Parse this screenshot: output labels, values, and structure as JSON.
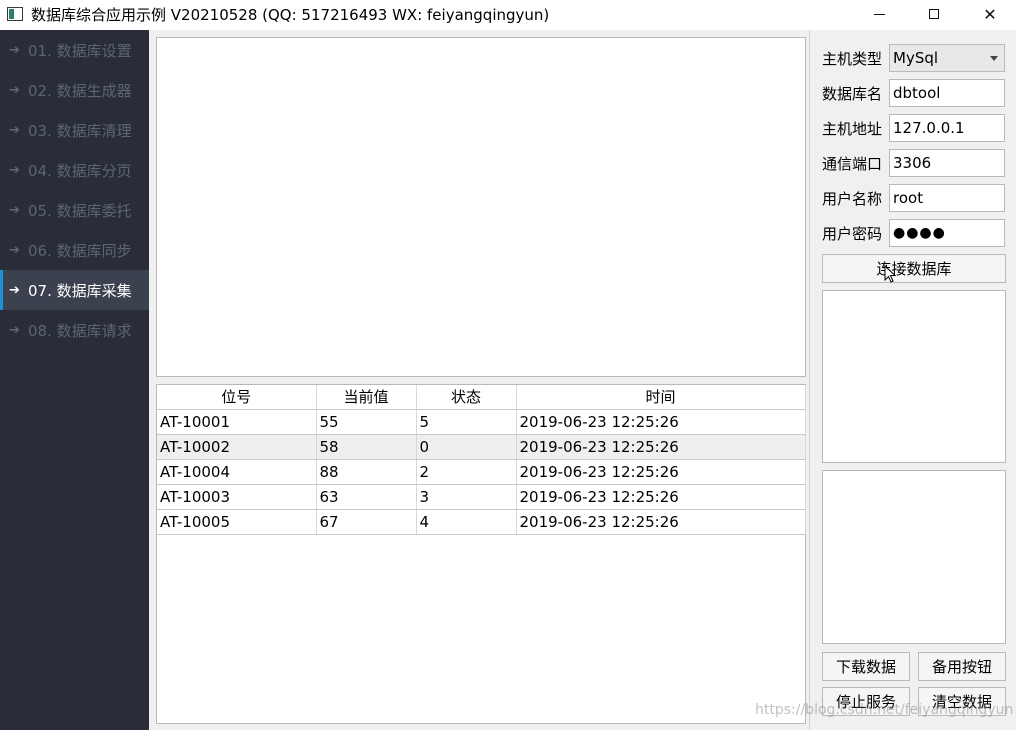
{
  "window": {
    "title": "数据库综合应用示例 V20210528 (QQ: 517216493 WX: feiyangqingyun)"
  },
  "sidebar": {
    "items": [
      {
        "label": "01. 数据库设置"
      },
      {
        "label": "02. 数据生成器"
      },
      {
        "label": "03. 数据库清理"
      },
      {
        "label": "04. 数据库分页"
      },
      {
        "label": "05. 数据库委托"
      },
      {
        "label": "06. 数据库同步"
      },
      {
        "label": "07. 数据库采集",
        "active": true
      },
      {
        "label": "08. 数据库请求"
      }
    ]
  },
  "table": {
    "headers": [
      "位号",
      "当前值",
      "状态",
      "时间"
    ],
    "rows": [
      [
        "AT-10001",
        "55",
        "5",
        "2019-06-23 12:25:26"
      ],
      [
        "AT-10002",
        "58",
        "0",
        "2019-06-23 12:25:26"
      ],
      [
        "AT-10004",
        "88",
        "2",
        "2019-06-23 12:25:26"
      ],
      [
        "AT-10003",
        "63",
        "3",
        "2019-06-23 12:25:26"
      ],
      [
        "AT-10005",
        "67",
        "4",
        "2019-06-23 12:25:26"
      ]
    ]
  },
  "form": {
    "host_type_label": "主机类型",
    "host_type_value": "MySql",
    "db_name_label": "数据库名",
    "db_name_value": "dbtool",
    "host_addr_label": "主机地址",
    "host_addr_value": "127.0.0.1",
    "port_label": "通信端口",
    "port_value": "3306",
    "user_label": "用户名称",
    "user_value": "root",
    "password_label": "用户密码",
    "password_value": "●●●●",
    "connect_button": "连接数据库"
  },
  "buttons": {
    "download": "下载数据",
    "spare": "备用按钮",
    "stop": "停止服务",
    "clear": "清空数据"
  },
  "watermark": "https://blog.csdn.net/feiyangqingyun",
  "colors": {
    "sidebar_bg": "#292d38",
    "sidebar_active_bg": "#3c4150",
    "accent": "#1e90d6"
  }
}
